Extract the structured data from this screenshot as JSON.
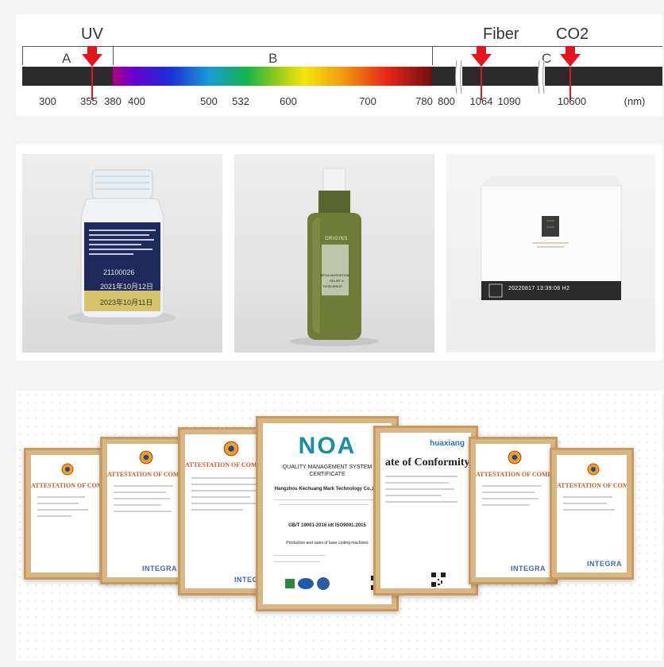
{
  "spectrum": {
    "labels": {
      "uv": "UV",
      "fiber": "Fiber",
      "co2": "CO2"
    },
    "regions": {
      "a": "A",
      "b": "B",
      "c": "C"
    },
    "ticks": [
      "300",
      "355",
      "380",
      "400",
      "500",
      "532",
      "600",
      "700",
      "780",
      "800",
      "1064",
      "1090",
      "10600"
    ],
    "unit": "(nm)",
    "colors": {
      "bar_dark": "#2b2b2b",
      "arrow": "#e8141b"
    }
  },
  "products": {
    "jar": {
      "label_lines": [
        "21100026",
        "2021年10月12日",
        "2023年10月11日"
      ]
    },
    "bottle": {
      "brand": "ORIGINS",
      "label_lines": [
        "MEGA-MUSHROOM",
        "RELIEF &",
        "RESILIENCE"
      ]
    },
    "box": {
      "print_code": "20220817  13:39:08  H2"
    }
  },
  "certificates": {
    "attestation_title": "ATTESTATION OF COMPLIANCE",
    "integra": "INTEGRA",
    "noa": {
      "logo": "NOA",
      "title_1": "QUALITY MANAGEMENT SYSTEM",
      "title_2": "CERTIFICATE",
      "company": "Hangzhou Kechuang Mark Technology Co.,Ltd",
      "standard": "GB/T 19001-2016 idt ISO9001:2015",
      "scope": "Production and sales of laser coding machines"
    },
    "conformity": {
      "title": "ate of Conformity",
      "brand": "huaxiang"
    }
  }
}
